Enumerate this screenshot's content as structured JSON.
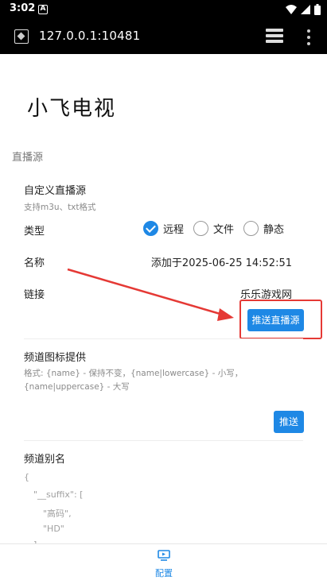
{
  "status_bar": {
    "time": "3:02",
    "notification_letter": "A"
  },
  "browser": {
    "url": "127.0.0.1:10481"
  },
  "page": {
    "title": "小飞电视",
    "section_title": "直播源"
  },
  "custom_source": {
    "heading": "自定义直播源",
    "hint": "支持m3u、txt格式",
    "type_label": "类型",
    "type_options": [
      "远程",
      "文件",
      "静态"
    ],
    "type_selected": "远程",
    "name_label": "名称",
    "name_value": "添加于2025-06-25 14:52:51",
    "link_label": "链接",
    "link_value": "乐乐游戏网",
    "push_button": "推送直播源"
  },
  "icon_provider": {
    "heading": "频道图标提供",
    "hint": "格式: {name} - 保持不变，{name|lowercase} - 小写，{name|uppercase} - 大写",
    "push_button": "推送"
  },
  "channel_alias": {
    "heading": "频道别名",
    "lines": [
      "{",
      "\"__suffix\": [",
      "\"高码\",",
      "\"HD\"",
      "],"
    ]
  },
  "bottom_nav": {
    "item_label": "配置",
    "accent_color": "#1e88e5"
  },
  "annotation": {
    "arrow_color": "#e53935"
  }
}
